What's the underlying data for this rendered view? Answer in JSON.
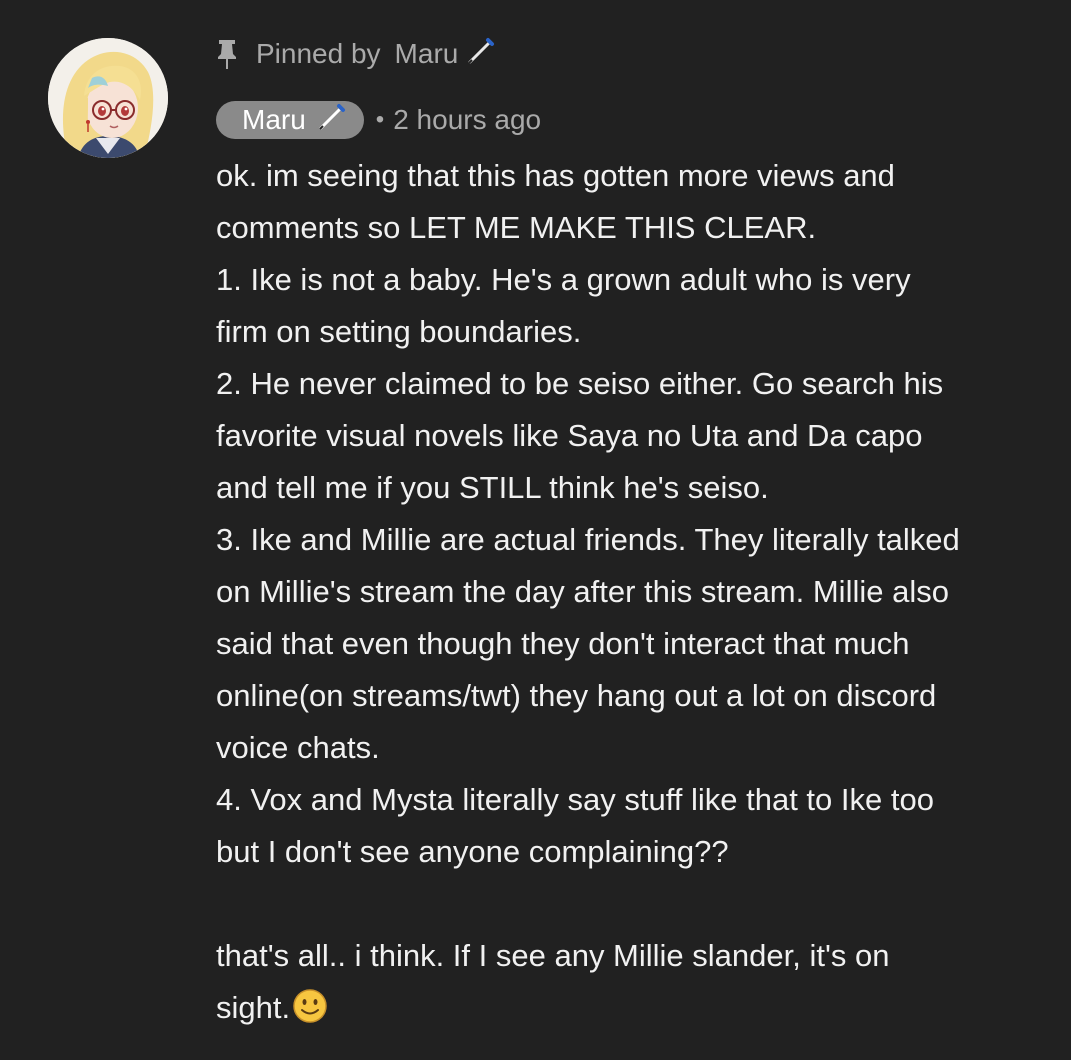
{
  "comment": {
    "pinned_label": "Pinned by",
    "pinned_by": "Maru",
    "author": "Maru",
    "separator": "•",
    "timestamp": "2 hours ago",
    "body_lines": [
      "ok. im seeing that this has gotten more views and",
      "comments so LET ME MAKE THIS CLEAR.",
      "1. Ike is not a baby. He's a grown adult who is very",
      "firm on setting boundaries.",
      "2. He never claimed to be seiso either. Go search his",
      "favorite visual novels like Saya no Uta and Da capo",
      "and tell me if you STILL think he's seiso.",
      "3. Ike and Millie are actual friends. They literally talked",
      "on Millie's stream the day after this stream. Millie also",
      "said that even though they don't interact that much",
      "online(on streams/twt) they hang out a lot on discord",
      "voice chats.",
      "4. Vox and Mysta literally say stuff like that to Ike too",
      "but I don't see anyone complaining??",
      "",
      "that's all.. i think. If I see any Millie slander, it's on",
      "sight."
    ],
    "icons": {
      "pin": "pin-icon",
      "pencil": "pencil-icon",
      "emoji": "slightly-smiling-face-icon",
      "avatar": "avatar-anime-character"
    },
    "colors": {
      "background": "#212121",
      "text": "#f1f1f1",
      "secondary_text": "#aaaaaa",
      "author_chip": "#8a8a8a",
      "emoji_yellow": "#f7c640"
    }
  }
}
